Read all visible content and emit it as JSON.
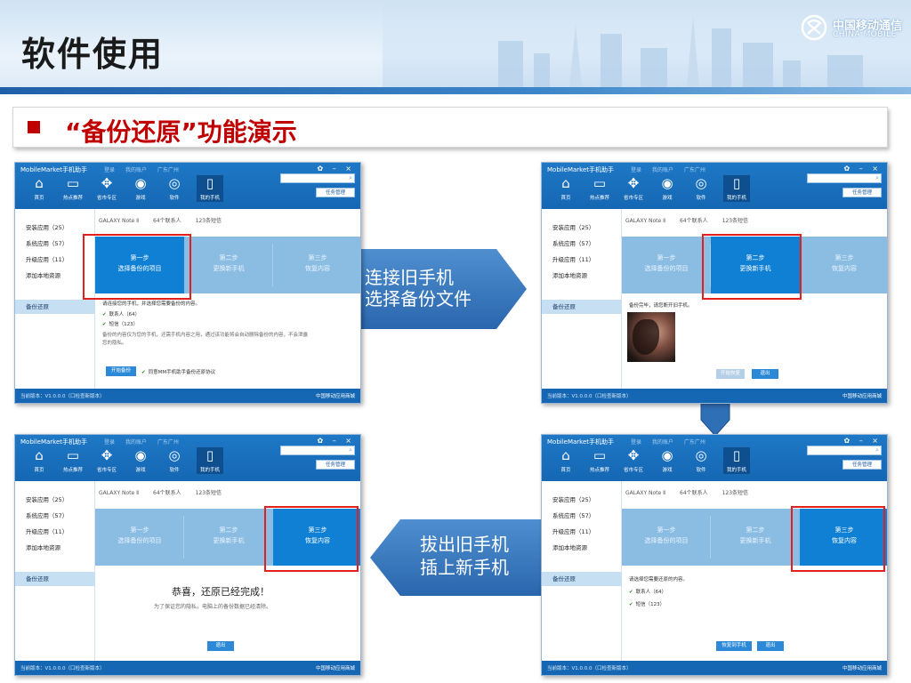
{
  "slide": {
    "title": "软件使用",
    "subtitle": "“备份还原”功能演示",
    "brand_cn": "中国移动通信",
    "brand_en": "CHINA MOBILE"
  },
  "arrows": {
    "right": {
      "line1": "连接旧手机",
      "line2": "选择备份文件"
    },
    "left": {
      "line1": "拔出旧手机",
      "line2": "插上新手机"
    }
  },
  "app": {
    "title": "MobileMarket手机助手",
    "menu": [
      "登录",
      "我的账户",
      "广东广州"
    ],
    "window_controls": "✿ – ×",
    "nav": [
      {
        "label": "首页",
        "icon": "home-icon",
        "glyph": "⌂"
      },
      {
        "label": "热点推荐",
        "icon": "hot-icon",
        "glyph": "▭"
      },
      {
        "label": "省市专区",
        "icon": "region-icon",
        "glyph": "✥"
      },
      {
        "label": "游戏",
        "icon": "gamepad-icon",
        "glyph": "◉"
      },
      {
        "label": "软件",
        "icon": "software-icon",
        "glyph": "◎"
      },
      {
        "label": "我的手机",
        "icon": "phone-icon",
        "glyph": "▯"
      }
    ],
    "task_button": "任务管理",
    "sidebar": [
      "安装应用（25）",
      "系统应用（57）",
      "升级应用（11）",
      "添加本地资源"
    ],
    "sidebar_backup": "备份还原",
    "device": {
      "model": "GALAXY Note Ⅱ",
      "contacts": "64个联系人",
      "sms": "123条短信"
    },
    "steps": [
      {
        "t": "第一步",
        "s": "选择备份的项目"
      },
      {
        "t": "第二步",
        "s": "更换新手机"
      },
      {
        "t": "第三步",
        "s": "恢复内容"
      }
    ],
    "status_left": "当前版本：V1.0.0.0（口检查新版本）",
    "status_right": "中国移动应用商城"
  },
  "screens": {
    "s1": {
      "line1": "请连接您的手机，并选择您需要备份的内容。",
      "item1": "联系人（64）",
      "item2": "短信（123）",
      "note1": "备份的内容仅为您的手机，还需手机内容之用，通过该功能将会自动删除备份的内容，不会泄露",
      "note2": "您的隐私。",
      "start_button": "开始备份",
      "option": "同意MM手机助手备份还原协议"
    },
    "s2": {
      "line": "备份完毕，请您断开旧手机。",
      "prev_button": "开始恢复",
      "exit_button": "退出"
    },
    "s3": {
      "line": "请选择您需要还原的内容。",
      "item1": "联系人（64）",
      "item2": "短信（123）",
      "restore_button": "恢复到手机",
      "exit_button": "退出"
    },
    "s4": {
      "congrats": "恭喜，还原已经完成！",
      "hint": "为了保证您的隐私，电脑上的备份数据已经清除。",
      "exit_button": "退出"
    }
  },
  "colors": {
    "accent": "#0f80d4",
    "highlight": "#e1201f",
    "header": "#1e78c6",
    "subtitle": "#c00000"
  }
}
